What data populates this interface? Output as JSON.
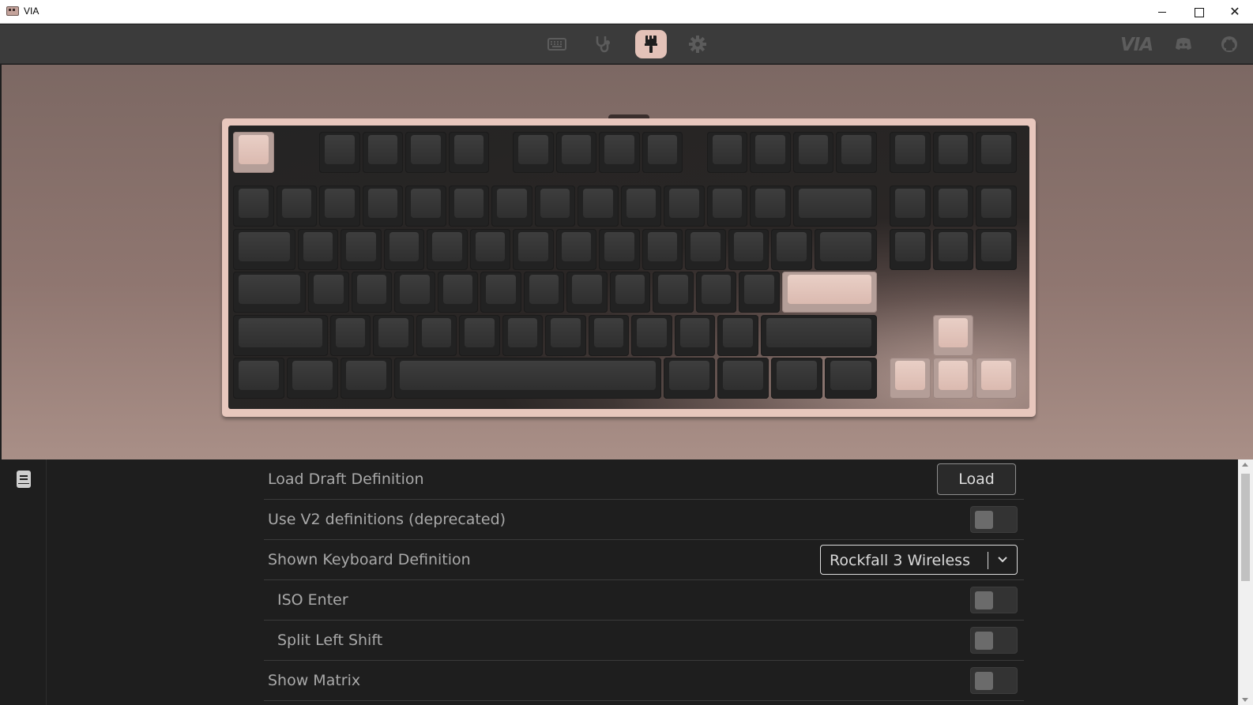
{
  "window": {
    "title": "VIA",
    "controls": [
      "minimize",
      "maximize",
      "close"
    ]
  },
  "nav": {
    "items": [
      {
        "name": "configure",
        "icon": "keyboard-icon",
        "active": false
      },
      {
        "name": "test",
        "icon": "stethoscope-icon",
        "active": false
      },
      {
        "name": "design",
        "icon": "paintbrush-icon",
        "active": true
      },
      {
        "name": "settings",
        "icon": "gear-icon",
        "active": false
      }
    ],
    "right_links": [
      {
        "name": "via-logo",
        "text": "VIA"
      },
      {
        "name": "discord",
        "icon": "discord-icon"
      },
      {
        "name": "github",
        "icon": "github-icon"
      }
    ],
    "active_color": "#e3c2b8"
  },
  "keyboard": {
    "layout": "TKL",
    "accent_color": "#e3c2b8",
    "base_color": "#3a3a3a",
    "case_color": "#e8c7bd"
  },
  "settings": {
    "load_draft": {
      "label": "Load Draft Definition",
      "button": "Load"
    },
    "v2_definitions": {
      "label": "Use V2 definitions (deprecated)",
      "enabled": false
    },
    "shown_definition": {
      "label": "Shown Keyboard Definition",
      "value": "Rockfall 3 Wireless"
    },
    "iso_enter": {
      "label": "ISO Enter",
      "enabled": false
    },
    "split_left_shift": {
      "label": "Split Left Shift",
      "enabled": false
    },
    "show_matrix": {
      "label": "Show Matrix",
      "enabled": false
    }
  },
  "sidebar": {
    "icon": "docs-icon"
  }
}
